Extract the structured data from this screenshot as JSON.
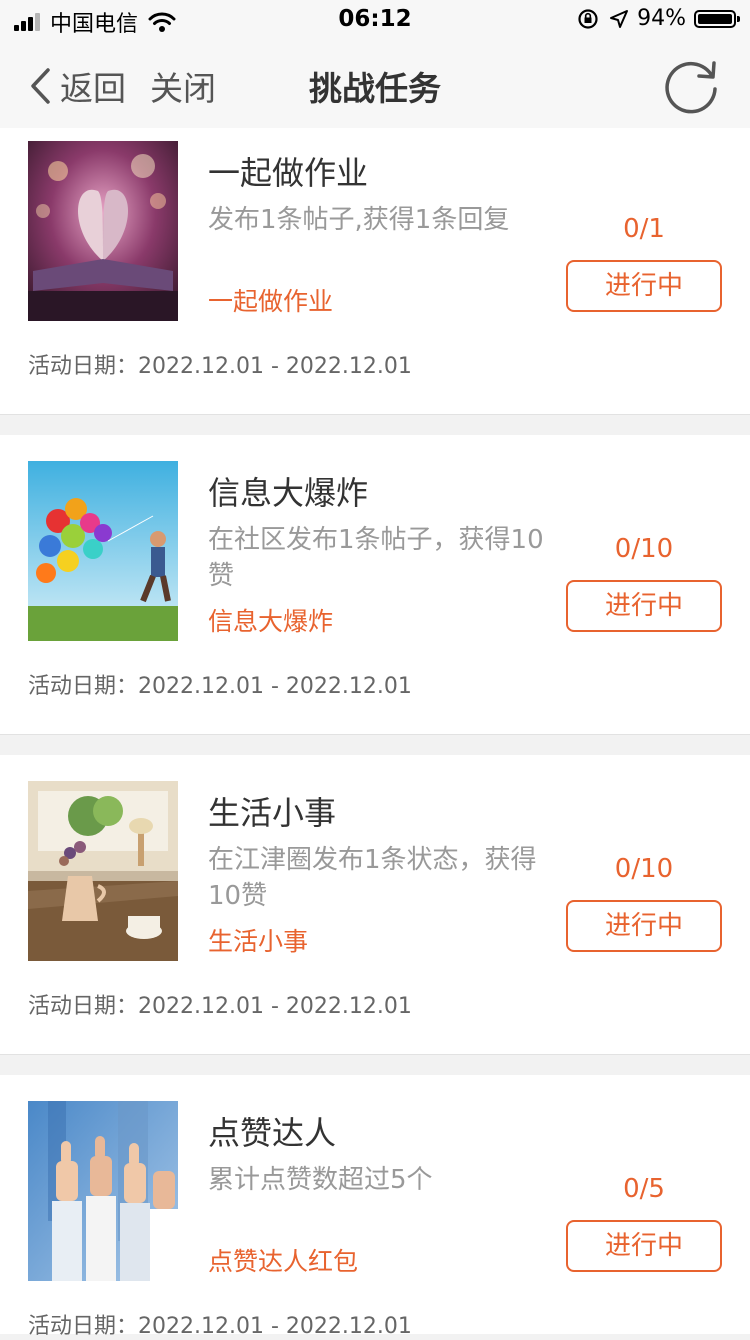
{
  "status_bar": {
    "carrier": "中国电信",
    "time": "06:12",
    "battery_pct": "94%"
  },
  "nav": {
    "back_label": "返回",
    "close_label": "关闭",
    "title": "挑战任务"
  },
  "tasks": [
    {
      "title": "一起做作业",
      "desc": "发布1条帖子,获得1条回复",
      "reward": "一起做作业",
      "progress": "0/1",
      "status": "进行中",
      "date_label": "活动日期：",
      "date_range": "2022.12.01 - 2022.12.01"
    },
    {
      "title": "信息大爆炸",
      "desc": "在社区发布1条帖子，获得10赞",
      "reward": "信息大爆炸",
      "progress": "0/10",
      "status": "进行中",
      "date_label": "活动日期：",
      "date_range": "2022.12.01 - 2022.12.01"
    },
    {
      "title": "生活小事",
      "desc": "在江津圈发布1条状态，获得10赞",
      "reward": "生活小事",
      "progress": "0/10",
      "status": "进行中",
      "date_label": "活动日期：",
      "date_range": "2022.12.01 - 2022.12.01"
    },
    {
      "title": "点赞达人",
      "desc": "累计点赞数超过5个",
      "reward": "点赞达人红包",
      "progress": "0/5",
      "status": "进行中",
      "date_label": "活动日期：",
      "date_range": "2022.12.01 - 2022.12.01"
    }
  ],
  "colors": {
    "accent": "#e8632f",
    "background": "#f2f2f2"
  }
}
